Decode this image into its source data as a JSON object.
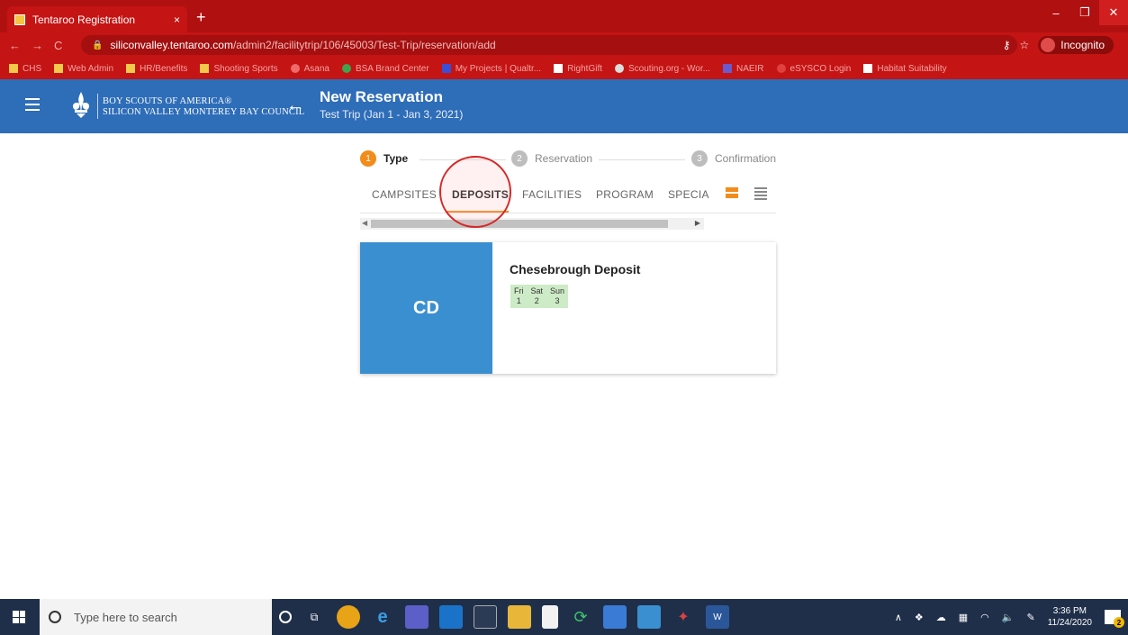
{
  "browser": {
    "tab_title": "Tentaroo Registration",
    "tab_close": "×",
    "new_tab": "+",
    "win_minimize": "–",
    "win_restore": "❐",
    "win_close": "✕",
    "url_host": "siliconvalley.tentaroo.com",
    "url_path": "/admin2/facilitytrip/106/45003/Test-Trip/reservation/add",
    "incognito_label": "Incognito",
    "bookmarks": [
      "CHS",
      "Web Admin",
      "HR/Benefits",
      "Shooting Sports",
      "Asana",
      "BSA Brand Center",
      "My Projects | Qualtr...",
      "RightGift",
      "Scouting.org - Wor...",
      "NAEIR",
      "eSYSCO Login",
      "Habitat Suitability"
    ]
  },
  "header": {
    "org_line1": "BOY SCOUTS OF AMERICA®",
    "org_line2": "SILICON VALLEY MONTEREY BAY COUNCIL",
    "title": "New Reservation",
    "subtitle": "Test Trip (Jan 1 - Jan 3, 2021)"
  },
  "stepper": {
    "steps": [
      {
        "num": "1",
        "label": "Type"
      },
      {
        "num": "2",
        "label": "Reservation"
      },
      {
        "num": "3",
        "label": "Confirmation"
      }
    ]
  },
  "tabs": [
    "CAMPSITES",
    "DEPOSITS",
    "FACILITIES",
    "PROGRAM",
    "SPECIA"
  ],
  "card": {
    "initials": "CD",
    "title": "Chesebrough Deposit",
    "days": [
      {
        "dow": "Fri",
        "num": "1"
      },
      {
        "dow": "Sat",
        "num": "2"
      },
      {
        "dow": "Sun",
        "num": "3"
      }
    ]
  },
  "taskbar": {
    "search_placeholder": "Type here to search",
    "time": "3:36 PM",
    "date": "11/24/2020",
    "notification_count": "2"
  },
  "colors": {
    "browser_chrome": "#c41414",
    "app_header": "#2e6db8",
    "accent": "#f28c1b",
    "card_thumb": "#3a8fd0",
    "availability": "#cdebc6"
  }
}
